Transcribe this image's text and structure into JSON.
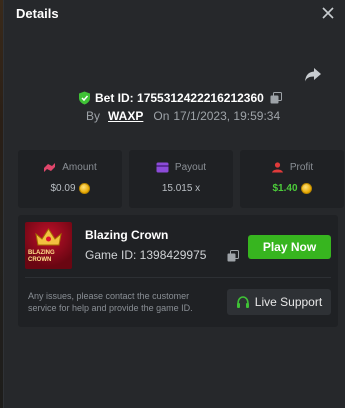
{
  "header": {
    "title": "Details"
  },
  "bet": {
    "id_label": "Bet ID:",
    "id_value": "1755312422216212360",
    "by_label": "By",
    "user": "WAXP",
    "on_label": "On",
    "datetime": "17/1/2023, 19:59:34"
  },
  "stats": [
    {
      "label": "Amount",
      "value": "$0.09",
      "icon": "amount-icon",
      "color": "#e0466b"
    },
    {
      "label": "Payout",
      "value": "15.015 x",
      "icon": "payout-icon",
      "color": "#8c4bd9"
    },
    {
      "label": "Profit",
      "value": "$1.40",
      "icon": "profit-icon",
      "color": "#e03a3a"
    }
  ],
  "game": {
    "name": "Blazing Crown",
    "id_text": "Game ID: 1398429975",
    "thumb_line1": "BLAZING",
    "thumb_line2": "CROWN",
    "play_label": "Play Now"
  },
  "support": {
    "text": "Any issues, please contact the customer service for help and provide the game ID.",
    "button_label": "Live Support"
  },
  "colors": {
    "accent_green": "#37b51f",
    "profit_green": "#4ccc3a",
    "panel": "#26282b",
    "card": "#1f2124"
  }
}
